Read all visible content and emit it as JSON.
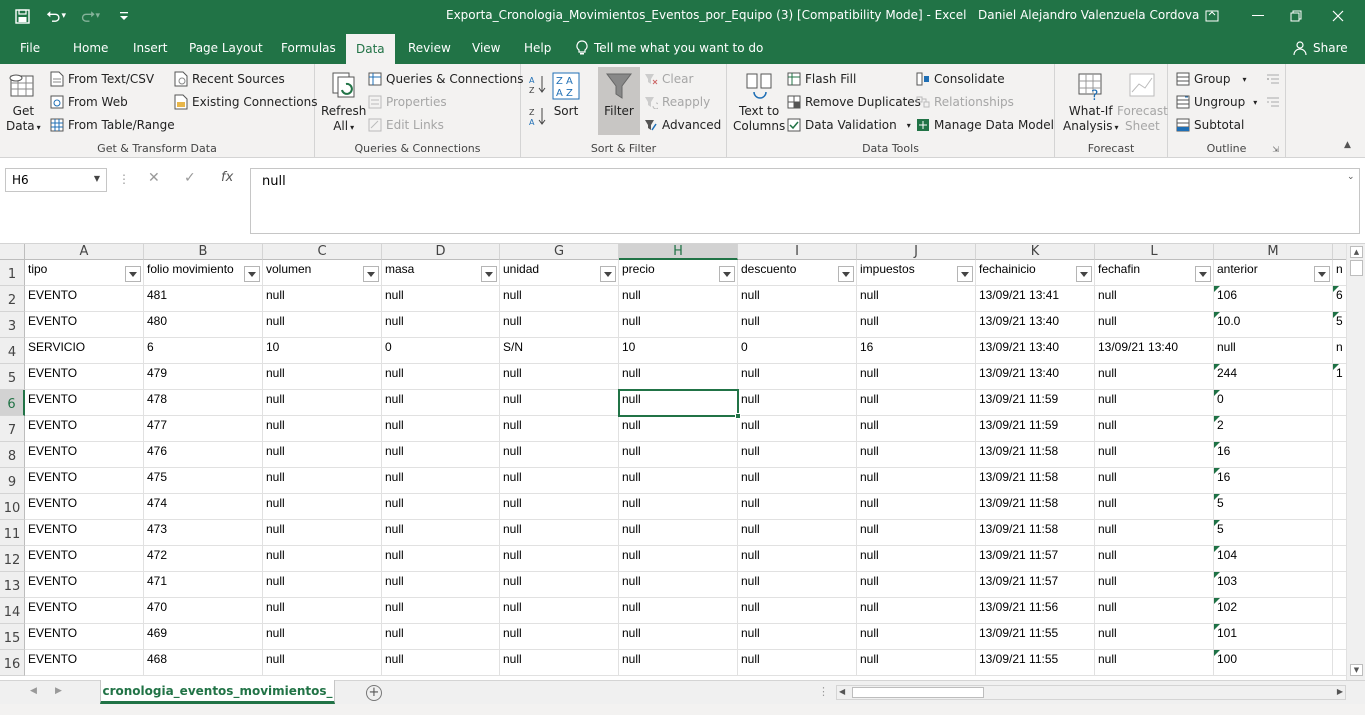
{
  "window": {
    "title": "Exporta_Cronologia_Movimientos_Eventos_por_Equipo (3)  [Compatibility Mode]  -  Excel",
    "user": "Daniel Alejandro Valenzuela Cordova"
  },
  "tabs": [
    "File",
    "Home",
    "Insert",
    "Page Layout",
    "Formulas",
    "Data",
    "Review",
    "View",
    "Help"
  ],
  "active_tab": "Data",
  "tell_me": "Tell me what you want to do",
  "share": "Share",
  "ribbon": {
    "get_transform": {
      "label": "Get & Transform Data",
      "get_data": "Get",
      "get_data2": "Data",
      "from_text": "From Text/CSV",
      "from_web": "From Web",
      "from_table": "From Table/Range",
      "recent_sources": "Recent Sources",
      "existing_connections": "Existing Connections"
    },
    "queries": {
      "label": "Queries & Connections",
      "refresh": "Refresh",
      "refresh2": "All",
      "queries_connections": "Queries & Connections",
      "properties": "Properties",
      "edit_links": "Edit Links"
    },
    "sort_filter": {
      "label": "Sort & Filter",
      "sort": "Sort",
      "filter": "Filter",
      "clear": "Clear",
      "reapply": "Reapply",
      "advanced": "Advanced"
    },
    "data_tools": {
      "label": "Data Tools",
      "text_to": "Text to",
      "columns": "Columns",
      "flash_fill": "Flash Fill",
      "remove_duplicates": "Remove Duplicates",
      "data_validation": "Data Validation",
      "consolidate": "Consolidate",
      "relationships": "Relationships",
      "manage_data_model": "Manage Data Model"
    },
    "forecast": {
      "label": "Forecast",
      "whatif": "What-If",
      "analysis": "Analysis",
      "forecast_sheet": "Forecast",
      "sheet": "Sheet"
    },
    "outline": {
      "label": "Outline",
      "group": "Group",
      "ungroup": "Ungroup",
      "subtotal": "Subtotal"
    }
  },
  "formula_bar": {
    "name_box": "H6",
    "fx": "fx",
    "value": "null"
  },
  "columns": [
    "A",
    "B",
    "C",
    "D",
    "G",
    "H",
    "I",
    "J",
    "K",
    "L",
    "M",
    ""
  ],
  "selected_column": "H",
  "rows": [
    [
      "tipo",
      "folio movimiento",
      "volumen",
      "masa",
      "unidad",
      "precio",
      "descuento",
      "impuestos",
      "fechainicio",
      "fechafin",
      "anterior",
      "n"
    ],
    [
      "EVENTO",
      "481",
      "null",
      "null",
      "null",
      "null",
      "null",
      "null",
      "13/09/21 13:41",
      "null",
      "106",
      "6"
    ],
    [
      "EVENTO",
      "480",
      "null",
      "null",
      "null",
      "null",
      "null",
      "null",
      "13/09/21 13:40",
      "null",
      "10.0",
      "5"
    ],
    [
      "SERVICIO",
      "6",
      "10",
      "0",
      "S/N",
      "10",
      "0",
      "16",
      "13/09/21 13:40",
      "13/09/21 13:40",
      "null",
      "n"
    ],
    [
      "EVENTO",
      "479",
      "null",
      "null",
      "null",
      "null",
      "null",
      "null",
      "13/09/21 13:40",
      "null",
      "244",
      "1"
    ],
    [
      "EVENTO",
      "478",
      "null",
      "null",
      "null",
      "null",
      "null",
      "null",
      "13/09/21 11:59",
      "null",
      "0",
      ""
    ],
    [
      "EVENTO",
      "477",
      "null",
      "null",
      "null",
      "null",
      "null",
      "null",
      "13/09/21 11:59",
      "null",
      "2",
      ""
    ],
    [
      "EVENTO",
      "476",
      "null",
      "null",
      "null",
      "null",
      "null",
      "null",
      "13/09/21 11:58",
      "null",
      "16",
      ""
    ],
    [
      "EVENTO",
      "475",
      "null",
      "null",
      "null",
      "null",
      "null",
      "null",
      "13/09/21 11:58",
      "null",
      "16",
      ""
    ],
    [
      "EVENTO",
      "474",
      "null",
      "null",
      "null",
      "null",
      "null",
      "null",
      "13/09/21 11:58",
      "null",
      "5",
      ""
    ],
    [
      "EVENTO",
      "473",
      "null",
      "null",
      "null",
      "null",
      "null",
      "null",
      "13/09/21 11:58",
      "null",
      "5",
      ""
    ],
    [
      "EVENTO",
      "472",
      "null",
      "null",
      "null",
      "null",
      "null",
      "null",
      "13/09/21 11:57",
      "null",
      "104",
      ""
    ],
    [
      "EVENTO",
      "471",
      "null",
      "null",
      "null",
      "null",
      "null",
      "null",
      "13/09/21 11:57",
      "null",
      "103",
      ""
    ],
    [
      "EVENTO",
      "470",
      "null",
      "null",
      "null",
      "null",
      "null",
      "null",
      "13/09/21 11:56",
      "null",
      "102",
      ""
    ],
    [
      "EVENTO",
      "469",
      "null",
      "null",
      "null",
      "null",
      "null",
      "null",
      "13/09/21 11:55",
      "null",
      "101",
      ""
    ],
    [
      "EVENTO",
      "468",
      "null",
      "null",
      "null",
      "null",
      "null",
      "null",
      "13/09/21 11:55",
      "null",
      "100",
      ""
    ]
  ],
  "row_numbers": [
    "1",
    "2",
    "3",
    "4",
    "5",
    "6",
    "7",
    "8",
    "9",
    "10",
    "11",
    "12",
    "13",
    "14",
    "15",
    "16"
  ],
  "selected_row": "6",
  "sheet_tab": "cronologia_eventos_movimientos_",
  "colors": {
    "accent": "#217346",
    "ribbon_bg": "#f3f2f1"
  }
}
